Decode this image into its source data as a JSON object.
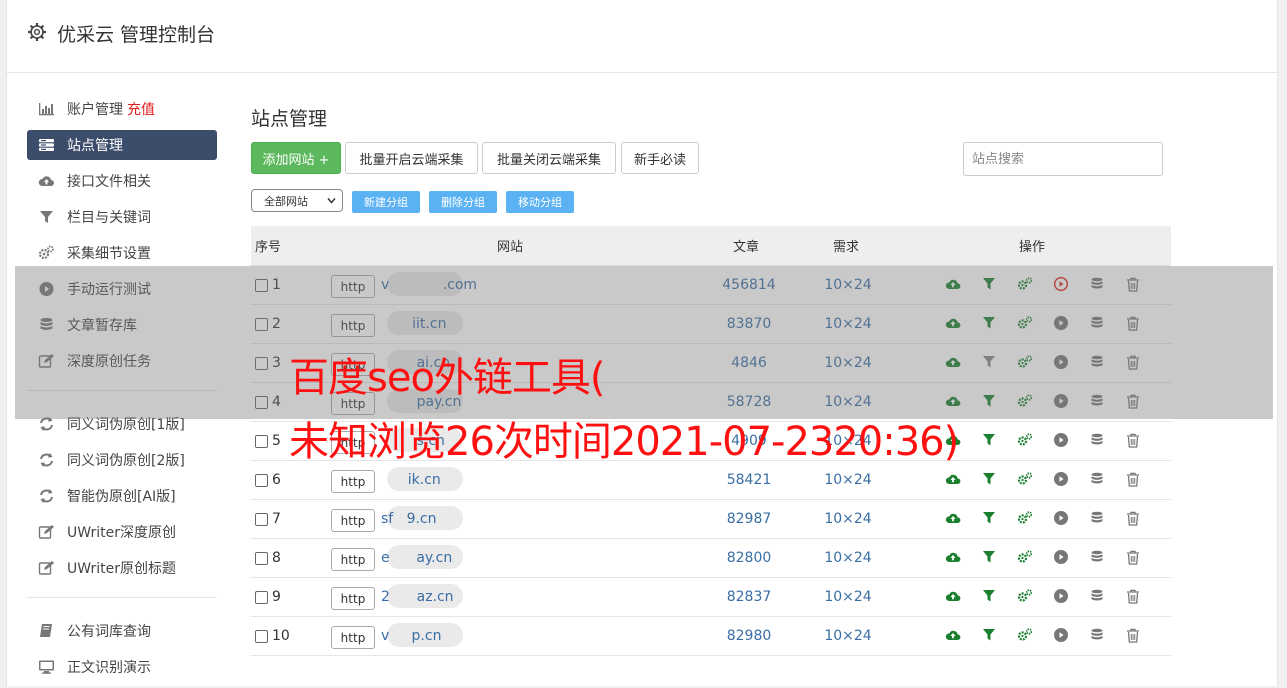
{
  "header": {
    "title": "优采云 管理控制台"
  },
  "sidebar": {
    "items": [
      {
        "label": "账户管理",
        "badge": "充值",
        "icon": "bar-chart-icon"
      },
      {
        "label": "站点管理",
        "icon": "server-icon",
        "active": true
      },
      {
        "label": "接口文件相关",
        "icon": "cloud-upload-icon"
      },
      {
        "label": "栏目与关键词",
        "icon": "filter-icon"
      },
      {
        "label": "采集细节设置",
        "icon": "gears-icon"
      },
      {
        "label": "手动运行测试",
        "icon": "play-circle-icon"
      },
      {
        "label": "文章暂存库",
        "icon": "database-icon"
      },
      {
        "label": "深度原创任务",
        "icon": "edit-icon"
      }
    ],
    "items2": [
      {
        "label": "同义词伪原创[1版]",
        "icon": "refresh-icon"
      },
      {
        "label": "同义词伪原创[2版]",
        "icon": "refresh-icon"
      },
      {
        "label": "智能伪原创[AI版]",
        "icon": "refresh-icon"
      },
      {
        "label": "UWriter深度原创",
        "icon": "edit-icon"
      },
      {
        "label": "UWriter原创标题",
        "icon": "edit-icon"
      }
    ],
    "items3": [
      {
        "label": "公有词库查询",
        "icon": "book-icon"
      },
      {
        "label": "正文识别演示",
        "icon": "monitor-icon"
      }
    ]
  },
  "main": {
    "title": "站点管理",
    "buttons": {
      "add": "添加网站 +",
      "batch_open": "批量开启云端采集",
      "batch_close": "批量关闭云端采集",
      "guide": "新手必读"
    },
    "search_placeholder": "站点搜索",
    "group_select": "全部网站",
    "group_buttons": {
      "new": "新建分组",
      "delete": "删除分组",
      "move": "移动分组"
    },
    "table": {
      "headers": {
        "no": "序号",
        "site": "网站",
        "articles": "文章",
        "demand": "需求",
        "actions": "操作"
      },
      "rows": [
        {
          "no": "1",
          "proto": "http",
          "site": "v            .com",
          "articles": "456814",
          "demand": "10×24"
        },
        {
          "no": "2",
          "proto": "http",
          "site": "       iit.cn",
          "articles": "83870",
          "demand": "10×24"
        },
        {
          "no": "3",
          "proto": "http",
          "site": "        ai.cn",
          "articles": "4846",
          "demand": "10×24"
        },
        {
          "no": "4",
          "proto": "http",
          "site": "        pay.cn",
          "articles": "58728",
          "demand": "10×24"
        },
        {
          "no": "5",
          "proto": "http",
          "site": "        s.cn",
          "articles": "4909",
          "demand": "10×24"
        },
        {
          "no": "6",
          "proto": "http",
          "site": "      ik.cn",
          "articles": "58421",
          "demand": "10×24"
        },
        {
          "no": "7",
          "proto": "http",
          "site": "sf   9.cn",
          "articles": "82987",
          "demand": "10×24"
        },
        {
          "no": "8",
          "proto": "http",
          "site": "e      ay.cn",
          "articles": "82800",
          "demand": "10×24"
        },
        {
          "no": "9",
          "proto": "http",
          "site": "2      az.cn",
          "articles": "82837",
          "demand": "10×24"
        },
        {
          "no": "10",
          "proto": "http",
          "site": "v     p.cn",
          "articles": "82980",
          "demand": "10×24"
        }
      ]
    }
  },
  "watermark": {
    "line1": "百度seo外链工具(",
    "line2": "未知浏览26次时间2021-07-2320:36)"
  },
  "colors": {
    "active_nav": "#3c4d6b",
    "add_button": "#5cb85c",
    "group_button": "#5bb2f3",
    "link": "#3a6ea5",
    "watermark": "#ff1010",
    "charge": "#e0201d"
  }
}
